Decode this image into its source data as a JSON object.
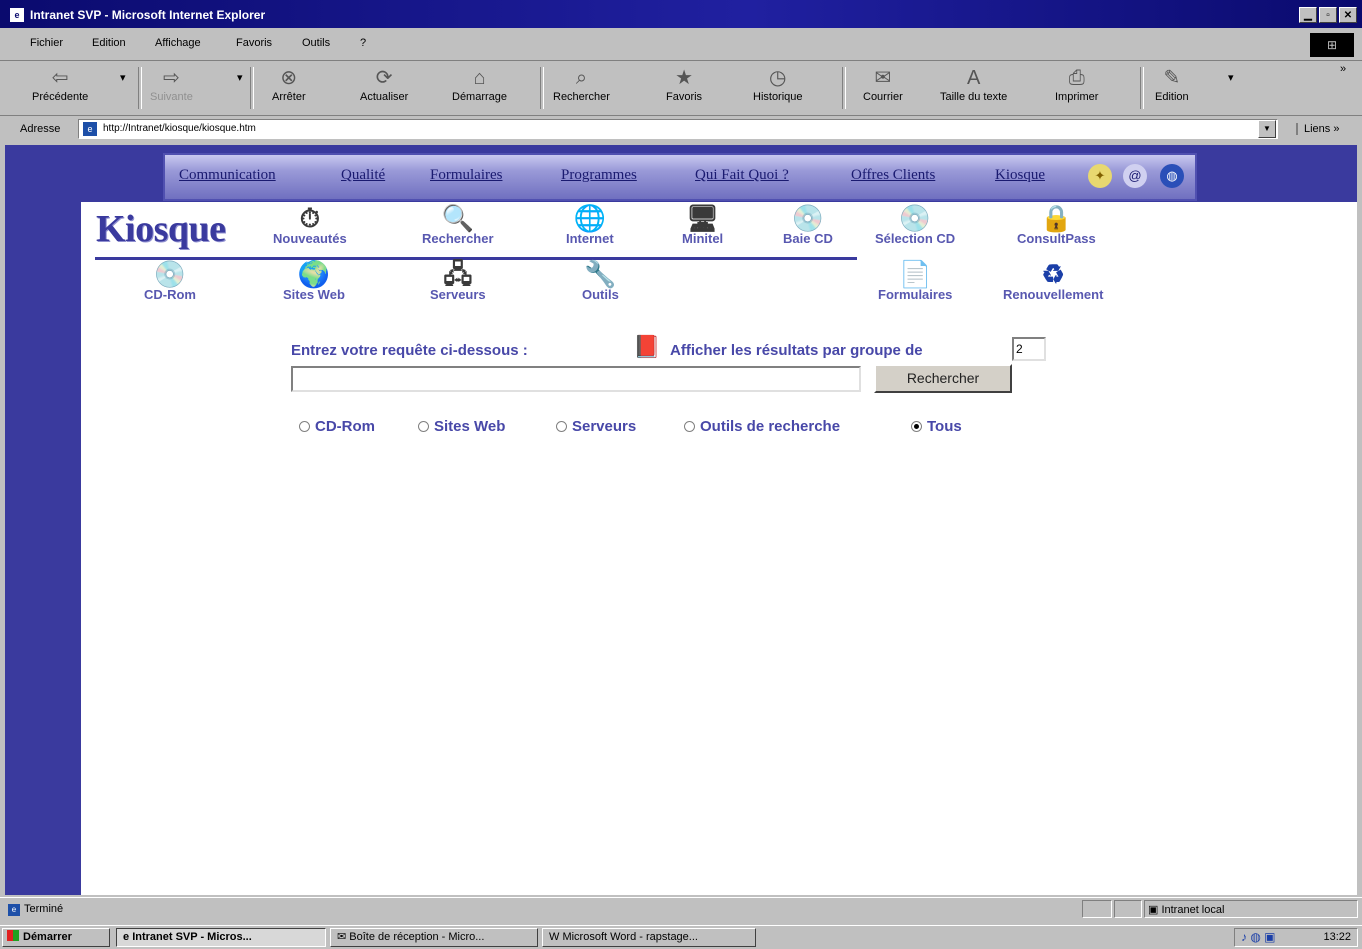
{
  "window": {
    "title": "Intranet SVP - Microsoft Internet Explorer",
    "controls": {
      "minimize": "▁",
      "maximize": "▫",
      "close": "✕"
    }
  },
  "menubar": {
    "items": [
      "Fichier",
      "Edition",
      "Affichage",
      "Favoris",
      "Outils",
      "?"
    ]
  },
  "toolbar": {
    "buttons": [
      {
        "label": "Précédente",
        "icon": "back-arrow-icon",
        "glyph": "⇦"
      },
      {
        "label": "Suivante",
        "icon": "forward-arrow-icon",
        "glyph": "⇨"
      },
      {
        "label": "Arrêter",
        "icon": "stop-icon",
        "glyph": "⊗"
      },
      {
        "label": "Actualiser",
        "icon": "refresh-icon",
        "glyph": "⟳"
      },
      {
        "label": "Démarrage",
        "icon": "home-icon",
        "glyph": "⌂"
      },
      {
        "label": "Rechercher",
        "icon": "search-icon",
        "glyph": "⌕"
      },
      {
        "label": "Favoris",
        "icon": "favorites-icon",
        "glyph": "★"
      },
      {
        "label": "Historique",
        "icon": "history-icon",
        "glyph": "◷"
      },
      {
        "label": "Courrier",
        "icon": "mail-icon",
        "glyph": "✉"
      },
      {
        "label": "Taille du texte",
        "icon": "text-size-icon",
        "glyph": "A"
      },
      {
        "label": "Imprimer",
        "icon": "print-icon",
        "glyph": "⎙"
      },
      {
        "label": "Edition",
        "icon": "edit-icon",
        "glyph": "✎"
      }
    ],
    "more": "»"
  },
  "addressbar": {
    "label": "Adresse",
    "url": "http://Intranet/kiosque/kiosque.htm",
    "links_label": "Liens",
    "links_more": "»"
  },
  "nav": {
    "items": [
      "Communication",
      "Qualité",
      "Formulaires",
      "Programmes",
      "Qui Fait Quoi ?",
      "Offres Clients",
      "Kiosque"
    ],
    "icons": [
      "lightbulb-icon",
      "at-sign-icon",
      "globe-icon"
    ]
  },
  "kiosque": {
    "logo": "Kiosque",
    "row1": [
      {
        "label": "Nouveautés",
        "icon": "stopwatch-icon",
        "glyph": "⏱",
        "tone": "ico-dark"
      },
      {
        "label": "Rechercher",
        "icon": "magnifier-icon",
        "glyph": "🔍",
        "tone": "ico-blue"
      },
      {
        "label": "Internet",
        "icon": "internet-globe-icon",
        "glyph": "🌐",
        "tone": "ico-blue"
      },
      {
        "label": "Minitel",
        "icon": "minitel-icon",
        "glyph": "🖥",
        "tone": "ico-dark"
      },
      {
        "label": "Baie CD",
        "icon": "cd-bay-icon",
        "glyph": "💿",
        "tone": "ico-gray"
      },
      {
        "label": "Sélection CD",
        "icon": "cd-selection-icon",
        "glyph": "💿",
        "tone": "ico-gray"
      },
      {
        "label": "ConsultPass",
        "icon": "padlock-icon",
        "glyph": "🔒",
        "tone": "ico-dark"
      }
    ],
    "row2": [
      {
        "label": "CD-Rom",
        "icon": "cdrom-icon",
        "glyph": "💿",
        "tone": "ico-gray"
      },
      {
        "label": "Sites Web",
        "icon": "websites-globe-icon",
        "glyph": "🌍",
        "tone": "ico-blue"
      },
      {
        "label": "Serveurs",
        "icon": "servers-icon",
        "glyph": "🖧",
        "tone": "ico-dark"
      },
      {
        "label": "Outils",
        "icon": "tools-icon",
        "glyph": "🔧",
        "tone": "ico-gray"
      },
      {
        "label": "Formulaires",
        "icon": "form-document-icon",
        "glyph": "📄",
        "tone": "ico-gray"
      },
      {
        "label": "Renouvellement",
        "icon": "renewal-icon",
        "glyph": "♻",
        "tone": "ico-blue"
      }
    ]
  },
  "search": {
    "prompt": "Entrez votre requête ci-dessous :",
    "group_label": "Afficher les résultats par groupe de",
    "group_value": "2",
    "query_value": "",
    "button": "Rechercher",
    "scopes": [
      {
        "label": "CD-Rom",
        "checked": false
      },
      {
        "label": "Sites Web",
        "checked": false
      },
      {
        "label": "Serveurs",
        "checked": false
      },
      {
        "label": "Outils de recherche",
        "checked": false
      },
      {
        "label": "Tous",
        "checked": true
      }
    ]
  },
  "statusbar": {
    "text": "Terminé",
    "zone": "Intranet local"
  },
  "taskbar": {
    "start": "Démarrer",
    "tasks": [
      {
        "label": "Intranet SVP - Micros...",
        "active": true
      },
      {
        "label": "Boîte de réception - Micro...",
        "active": false
      },
      {
        "label": "Microsoft Word - rapstage...",
        "active": false
      }
    ],
    "clock": "13:22"
  }
}
